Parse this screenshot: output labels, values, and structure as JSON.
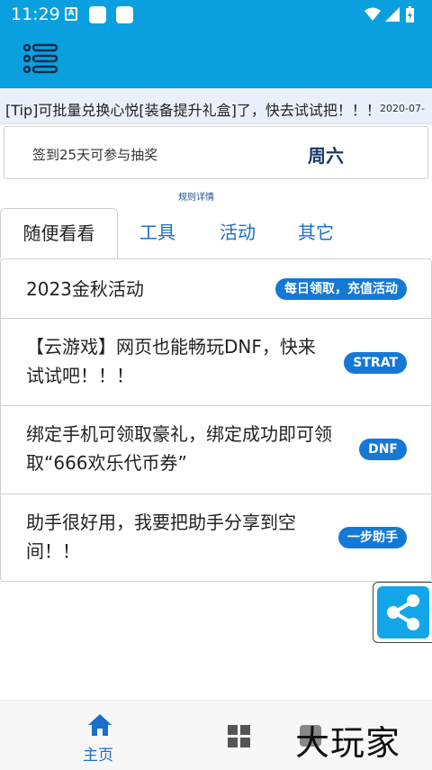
{
  "status_bar": {
    "time": "11:29",
    "notification_icon_letter": "A",
    "icons": [
      "wifi-icon",
      "signal-icon",
      "battery-icon"
    ]
  },
  "header": {
    "background_color": "#0aa0e0",
    "menu_icon": "list-menu-icon"
  },
  "notice": {
    "message": "[Tip]可批量兑换心悦[装备提升礼盒]了，快去试试把！！！",
    "date": "2020-07-"
  },
  "sign_in": {
    "tip": "签到25天可参与抽奖",
    "day": "周六",
    "rules_link": "规则详情"
  },
  "tabs": [
    {
      "label": "随便看看"
    },
    {
      "label": "工具"
    },
    {
      "label": "活动"
    },
    {
      "label": "其它"
    }
  ],
  "items": [
    {
      "title_lines": [
        "2023金秋活动"
      ],
      "badge": "每日领取，充值活动"
    },
    {
      "title_lines": [
        "【云游戏】网页也能畅玩DNF，快来",
        "试试吧！！！"
      ],
      "badge": "STRAT"
    },
    {
      "title_lines": [
        "绑定手机可领取豪礼，绑定成功即可领",
        "取“666欢乐代币券”"
      ],
      "badge": "DNF"
    },
    {
      "title_lines": [
        "助手很好用，我要把助手分享到空",
        "间！！"
      ],
      "badge": "一步助手"
    }
  ],
  "share_button": {
    "icon": "share-icon",
    "color": "#12a6e8"
  },
  "bottom_nav": {
    "home_label": "主页",
    "accent_color": "#1a6fc8",
    "icons": [
      "home-icon",
      "grid-icon",
      "third-icon"
    ]
  },
  "watermark": "大玩家"
}
